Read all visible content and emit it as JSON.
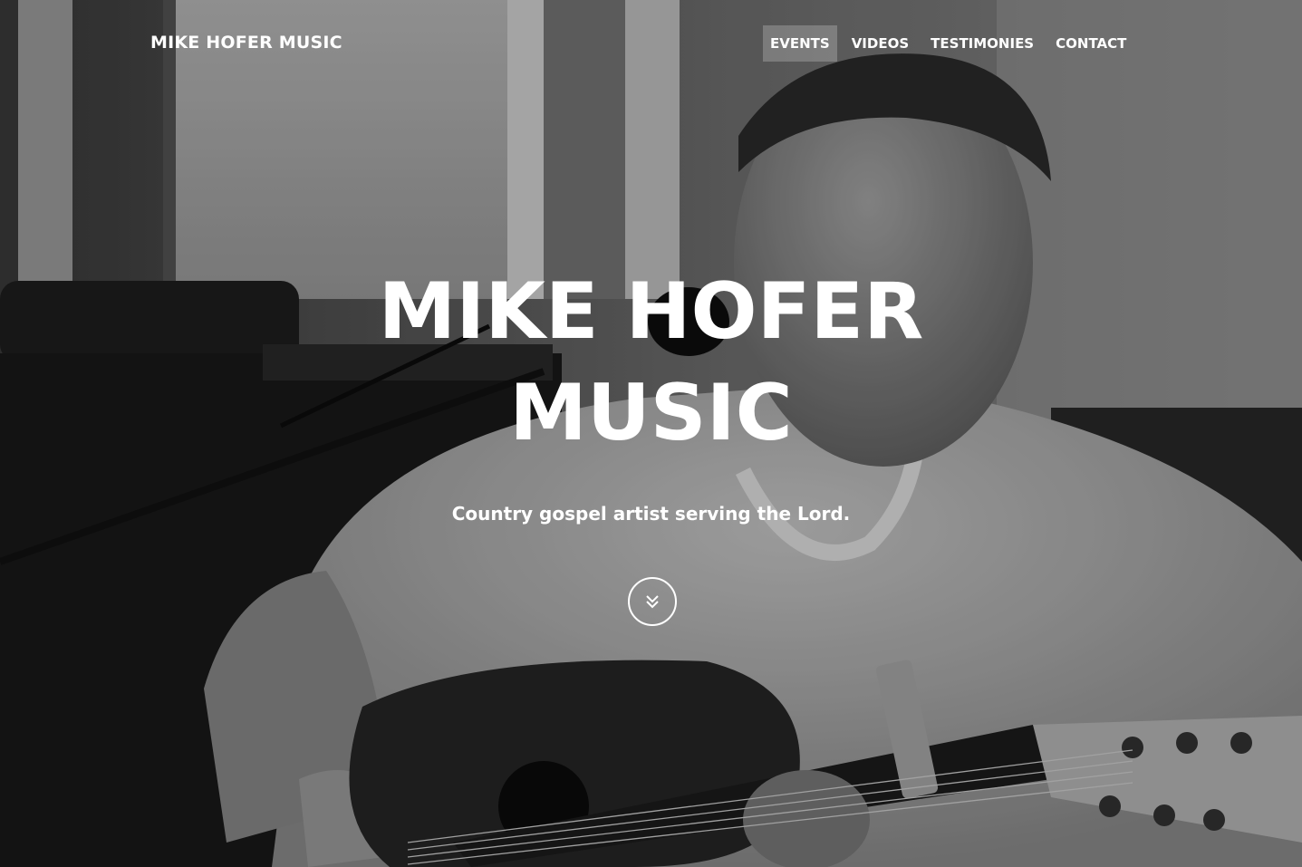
{
  "navbar": {
    "brand": "MIKE HOFER MUSIC",
    "items": [
      {
        "label": "EVENTS",
        "active": true
      },
      {
        "label": "VIDEOS",
        "active": false
      },
      {
        "label": "TESTIMONIES",
        "active": false
      },
      {
        "label": "CONTACT",
        "active": false
      }
    ]
  },
  "hero": {
    "title_line1": "MIKE HOFER",
    "title_line2": "MUSIC",
    "subtitle": "Country gospel artist serving the Lord.",
    "scroll_icon": "double-chevron-down-icon"
  },
  "colors": {
    "text": "#ffffff",
    "active_nav_bg": "rgba(255,255,255,0.22)"
  }
}
